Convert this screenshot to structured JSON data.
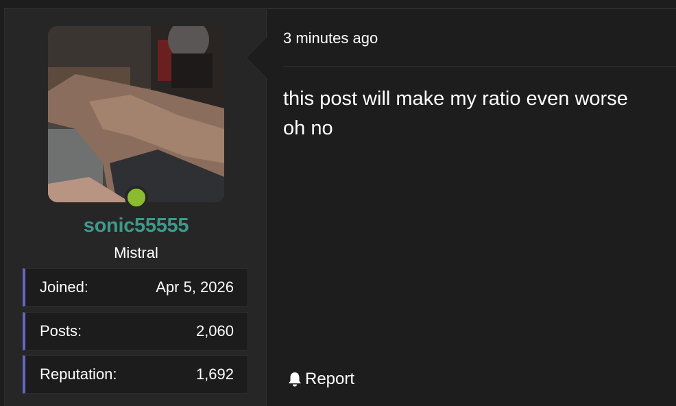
{
  "user": {
    "username": "sonic55555",
    "title": "Mistral",
    "online": true,
    "status_color": "#8bbb2e",
    "name_color": "#3d9a8b",
    "stats": [
      {
        "label": "Joined:",
        "value": "Apr 5, 2026"
      },
      {
        "label": "Posts:",
        "value": "2,060"
      },
      {
        "label": "Reputation:",
        "value": "1,692"
      }
    ],
    "stat_accent_color": "#6466c2"
  },
  "post": {
    "timestamp": "3 minutes ago",
    "lines": [
      "this post will make my ratio even worse",
      "oh no"
    ],
    "report_label": "Report",
    "report_icon": "bell-icon"
  }
}
